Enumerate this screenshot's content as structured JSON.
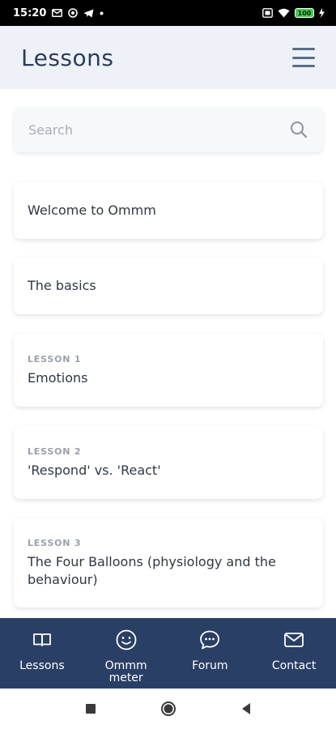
{
  "status_bar": {
    "time": "15:20",
    "battery": "100"
  },
  "header": {
    "title": "Lessons"
  },
  "search": {
    "placeholder": "Search",
    "value": ""
  },
  "lessons": [
    {
      "eyebrow": "",
      "title": "Welcome to Ommm"
    },
    {
      "eyebrow": "",
      "title": "The basics"
    },
    {
      "eyebrow": "LESSON 1",
      "title": "Emotions"
    },
    {
      "eyebrow": "LESSON 2",
      "title": "'Respond' vs. 'React'"
    },
    {
      "eyebrow": "LESSON 3",
      "title": "The Four Balloons (physiology and the behaviour)"
    }
  ],
  "bottom_nav": {
    "items": [
      {
        "label": "Lessons",
        "icon": "book-icon"
      },
      {
        "label": "Ommm meter",
        "icon": "smiley-icon"
      },
      {
        "label": "Forum",
        "icon": "chat-bubble-icon"
      },
      {
        "label": "Contact",
        "icon": "envelope-icon"
      }
    ]
  },
  "colors": {
    "header_bg": "#eef2f8",
    "title": "#2a3d5e",
    "bottom_nav_bg": "#2a3f66"
  }
}
